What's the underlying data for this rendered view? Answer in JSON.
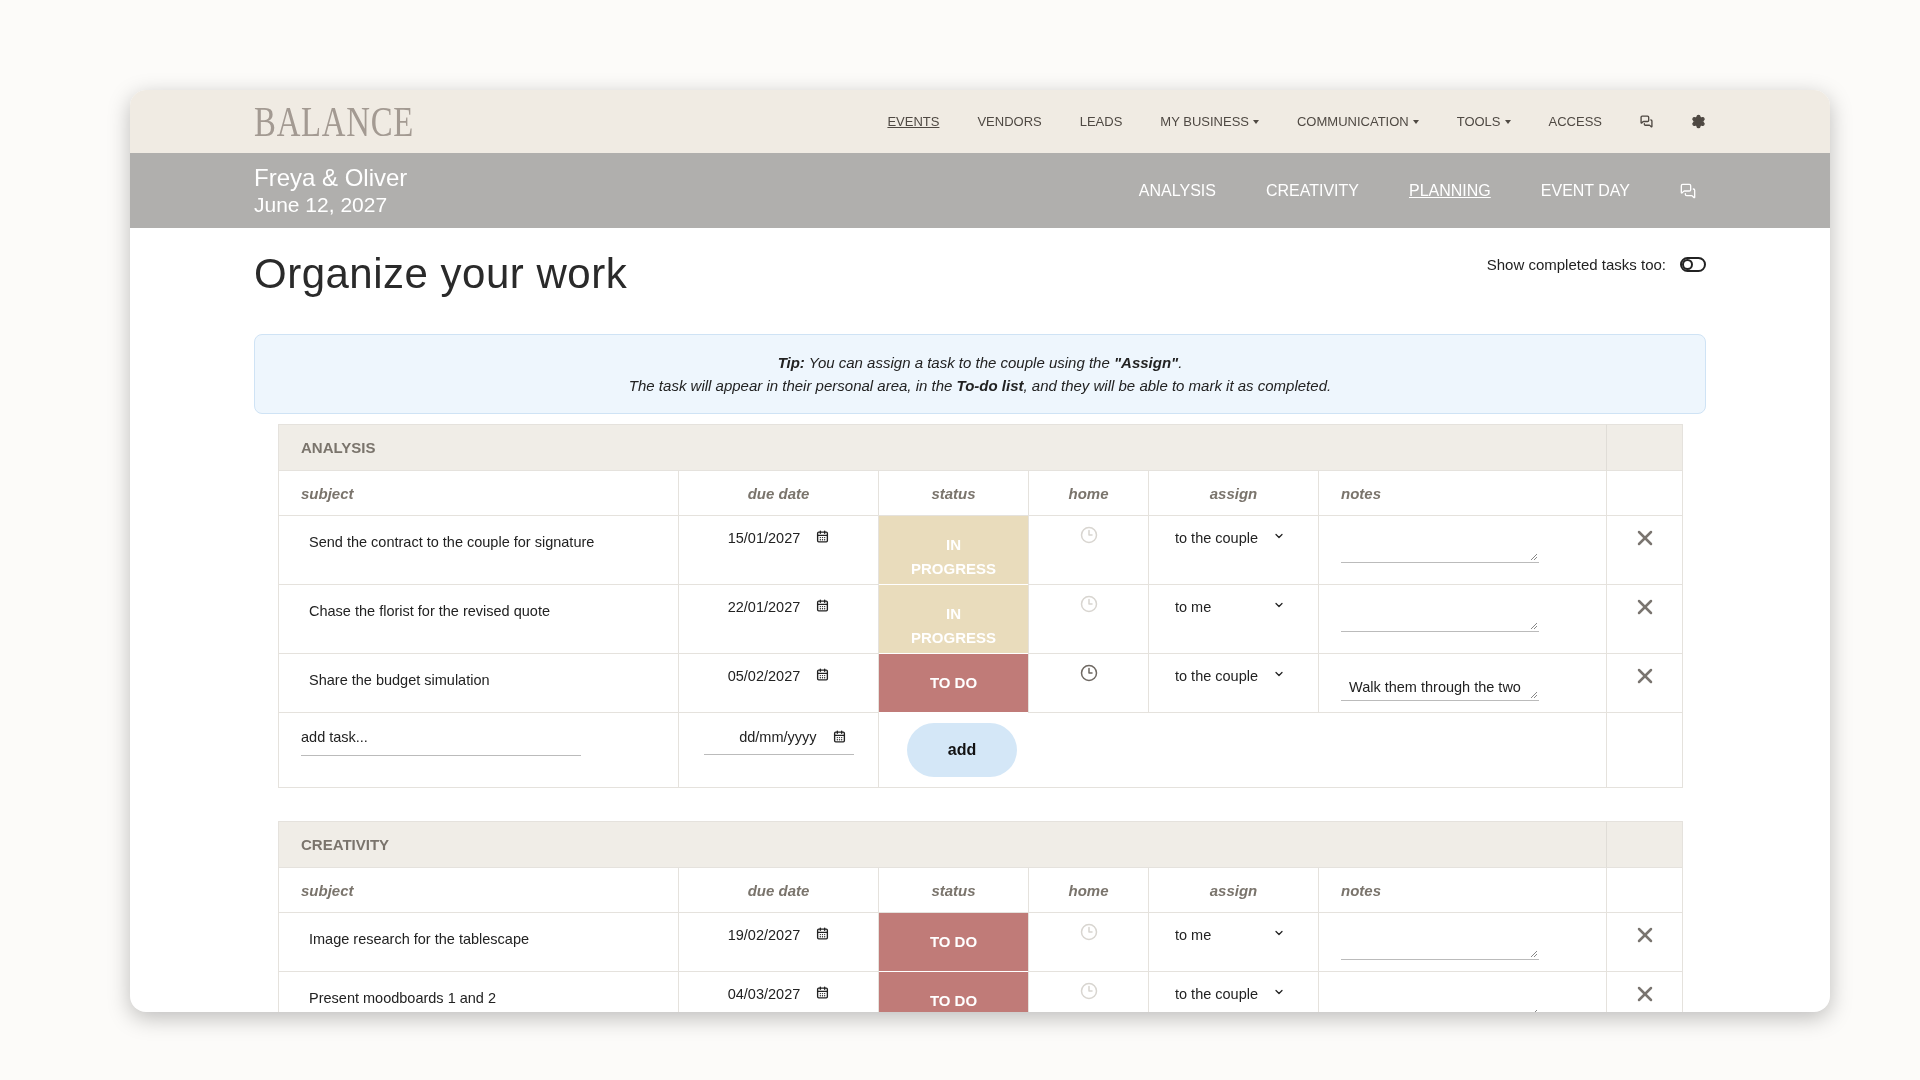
{
  "nav": {
    "logo": "BALANCE",
    "items": [
      {
        "label": "EVENTS",
        "selected": true,
        "dropdown": false
      },
      {
        "label": "VENDORS",
        "selected": false,
        "dropdown": false
      },
      {
        "label": "LEADS",
        "selected": false,
        "dropdown": false
      },
      {
        "label": "MY BUSINESS",
        "selected": false,
        "dropdown": true
      },
      {
        "label": "COMMUNICATION",
        "selected": false,
        "dropdown": true
      },
      {
        "label": "TOOLS",
        "selected": false,
        "dropdown": true
      },
      {
        "label": "ACCESS",
        "selected": false,
        "dropdown": false
      }
    ]
  },
  "event": {
    "names": "Freya & Oliver",
    "date": "June 12, 2027",
    "tabs": [
      {
        "label": "ANALYSIS",
        "selected": false
      },
      {
        "label": "CREATIVITY",
        "selected": false
      },
      {
        "label": "PLANNING",
        "selected": true
      },
      {
        "label": "EVENT DAY",
        "selected": false
      }
    ]
  },
  "page": {
    "title": "Organize your work",
    "toggle": {
      "label": "Show completed tasks too:",
      "on": false
    }
  },
  "tip": {
    "lines": [
      "**Tip:** You can assign a task to the couple using the **\"Assign\"**.",
      "The task will appear in their personal area, in the **To-do list**, and they will be able to mark it as completed."
    ]
  },
  "sections": [
    {
      "title": "ANALYSIS",
      "columns": [
        "subject",
        "due date",
        "status",
        "home",
        "assign",
        "notes"
      ],
      "tasks": [
        {
          "subject": "Send the contract to the couple for signature",
          "due_date": "15/01/2027",
          "status": {
            "kind": "in_progress",
            "label": "IN PROGRESS"
          },
          "home": false,
          "assign": "to the couple"
        },
        {
          "subject": "Chase the florist for the revised quote",
          "due_date": "22/01/2027",
          "status": {
            "kind": "in_progress",
            "label": "IN PROGRESS"
          },
          "home": false,
          "assign": "to me"
        },
        {
          "subject": "Share the budget simulation",
          "due_date": "05/02/2027",
          "status": {
            "kind": "todo",
            "label": "TO DO"
          },
          "home": true,
          "assign": "to the couple",
          "notes": "Walk them through the two"
        }
      ],
      "add_row": {
        "subject_placeholder": "add task...",
        "date_placeholder": "dd/mm/yyyy",
        "button": "add"
      }
    },
    {
      "title": "CREATIVITY",
      "columns": [
        "subject",
        "due date",
        "status",
        "home",
        "assign",
        "notes"
      ],
      "tasks": [
        {
          "subject": "Image research for the tablescape",
          "due_date": "19/02/2027",
          "status": {
            "kind": "todo",
            "label": "TO DO"
          },
          "home": false,
          "assign": "to me"
        },
        {
          "subject": "Present moodboards 1 and 2",
          "due_date": "04/03/2027",
          "status": {
            "kind": "todo",
            "label": "TO DO"
          },
          "home": false,
          "assign": "to the couple"
        }
      ]
    }
  ]
}
